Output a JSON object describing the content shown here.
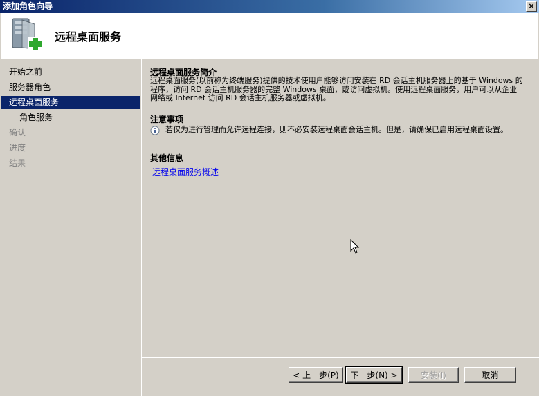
{
  "window": {
    "title": "添加角色向导",
    "close_glyph": "×"
  },
  "header": {
    "title": "远程桌面服务"
  },
  "sidebar": {
    "steps": [
      {
        "label": "开始之前",
        "state": "normal"
      },
      {
        "label": "服务器角色",
        "state": "normal"
      },
      {
        "label": "远程桌面服务",
        "state": "active"
      },
      {
        "label": "角色服务",
        "state": "normal"
      },
      {
        "label": "确认",
        "state": "disabled"
      },
      {
        "label": "进度",
        "state": "disabled"
      },
      {
        "label": "结果",
        "state": "disabled"
      }
    ]
  },
  "main": {
    "intro_title": "远程桌面服务简介",
    "intro_text": "远程桌面服务(以前称为终端服务)提供的技术使用户能够访问安装在 RD 会话主机服务器上的基于 Windows 的程序，访问 RD 会话主机服务器的完整 Windows 桌面，或访问虚拟机。使用远程桌面服务，用户可以从企业网络或 Internet 访问 RD 会话主机服务器或虚拟机。",
    "notes_title": "注意事项",
    "notes_text": "若仅为进行管理而允许远程连接，则不必安装远程桌面会话主机。但是，请确保已启用远程桌面设置。",
    "more_title": "其他信息",
    "more_link": "远程桌面服务概述"
  },
  "footer": {
    "prev_label": "< 上一步(P)",
    "next_label": "下一步(N) >",
    "install_label": "安装(I)",
    "cancel_label": "取消"
  }
}
